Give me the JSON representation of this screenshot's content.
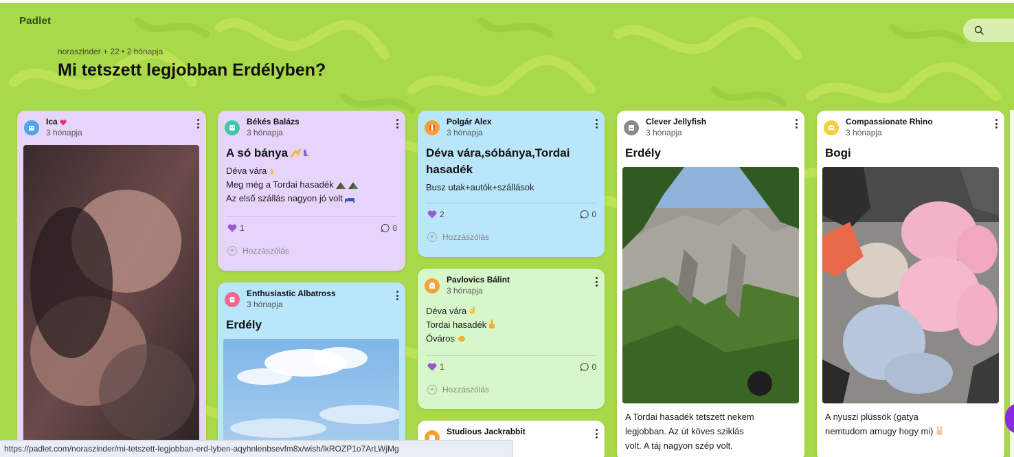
{
  "app": {
    "logo": "Padlet"
  },
  "board": {
    "meta": "noraszinder + 22 • 2 hónapja",
    "title": "Mi tetszett legjobban Erdélyben?"
  },
  "colors": {
    "background": "#a8d94a",
    "card_purple": "#e6d4fb",
    "card_blue": "#b9e6fa",
    "card_green": "#d6f7c9",
    "card_white": "#ffffff",
    "like": "#9b59d0",
    "fab": "#8a2be2"
  },
  "icons": {
    "search": "search-icon",
    "menu": "more-vertical-icon",
    "like": "heart-icon",
    "comment": "comment-bubble-icon",
    "add": "plus-icon"
  },
  "posts": {
    "ica": {
      "author": "Ica",
      "time": "3 hónapja"
    },
    "bekes": {
      "author": "Békés Balázs",
      "time": "3 hónapja",
      "title": "A só bánya",
      "lines": [
        "Déva vára",
        "Meg még a Tordai hasadék",
        "Az első szállás nagyon jó volt"
      ],
      "likes": "1",
      "comments": "0",
      "add_comment": "Hozzászólás"
    },
    "albatross": {
      "author": "Enthusiastic Albatross",
      "time": "3 hónapja",
      "title": "Erdély"
    },
    "polgar": {
      "author": "Polgár Alex",
      "time": "3 hónapja",
      "title_line1": "Déva vára,sóbánya,Tordai",
      "title_line2": "hasadék",
      "body": "Busz utak+autók+szállások",
      "likes": "2",
      "comments": "0",
      "add_comment": "Hozzászólás"
    },
    "pavlovics": {
      "author": "Pavlovics Bálint",
      "time": "3 hónapja",
      "lines": [
        "Déva vára",
        "Tordai hasadék",
        "Óváros"
      ],
      "likes": "1",
      "comments": "0",
      "add_comment": "Hozzászólás"
    },
    "jackrabbit": {
      "author": "Studious Jackrabbit"
    },
    "jellyfish": {
      "author": "Clever Jellyfish",
      "time": "3 hónapja",
      "title": "Erdély",
      "caption_lines": [
        "A Tordai hasadék tetszett nekem",
        "legjobban. Az út köves sziklás",
        "volt. A táj nagyon szép volt."
      ]
    },
    "rhino": {
      "author": "Compassionate Rhino",
      "time": "3 hónapja",
      "title": "Bogi",
      "caption_lines": [
        "A nyuszi plüssök (gatya",
        "nemtudom amugy hogy mi)"
      ]
    }
  },
  "status_url": "https://padlet.com/noraszinder/mi-tetszett-legjobban-erd-lyben-aqyhnlenbsevfm8x/wish/lkROZP1o7ArLWjMg"
}
